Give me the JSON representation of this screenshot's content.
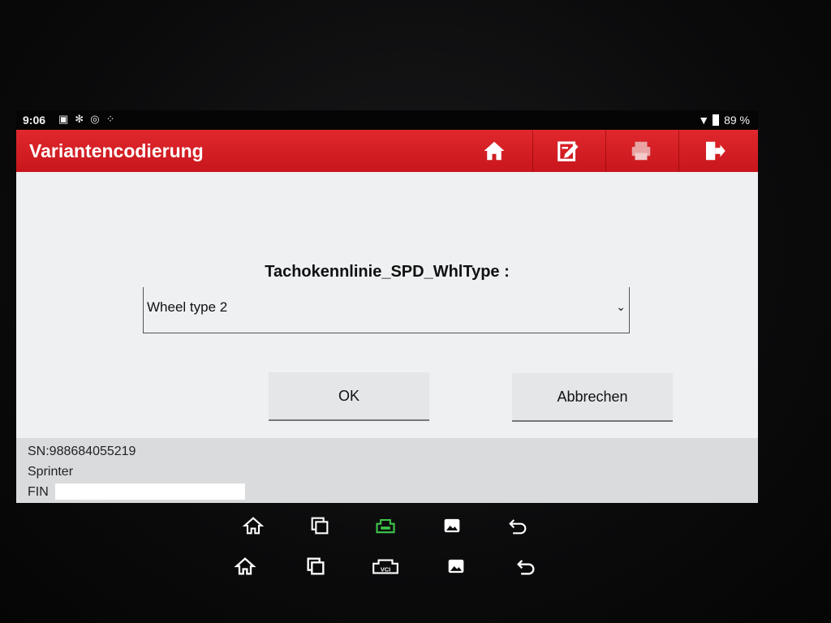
{
  "status": {
    "time": "9:06",
    "battery": "89 %"
  },
  "app": {
    "title": "Variantencodierung",
    "toolbar": {
      "home": "home-icon",
      "edit": "edit-icon",
      "print": "print-icon",
      "exit": "exit-icon"
    },
    "accent": "#d4181f"
  },
  "form": {
    "label": "Tachokennlinie_SPD_WhlType :",
    "select_value": "Wheel type 2",
    "ok_label": "OK",
    "cancel_label": "Abbrechen"
  },
  "footer": {
    "sn": "SN:988684055219",
    "model": "Sprinter",
    "fin_label": "FIN"
  },
  "nav": [
    "home-icon",
    "recents-icon",
    "vci-icon",
    "gallery-icon",
    "back-icon"
  ],
  "nav2": {
    "vci_label": "VCI"
  }
}
